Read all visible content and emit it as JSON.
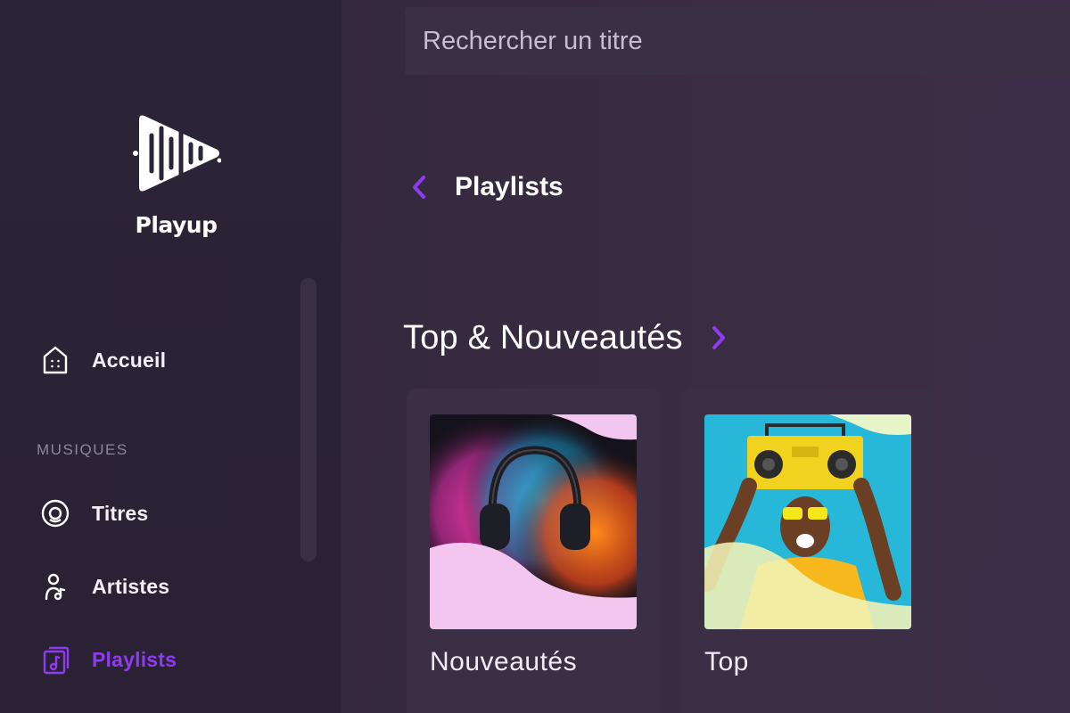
{
  "app": {
    "name": "Playup",
    "accent_color": "#8f3bf0"
  },
  "search": {
    "placeholder": "Rechercher un titre",
    "value": ""
  },
  "sidebar": {
    "home": {
      "label": "Accueil",
      "icon": "home-icon"
    },
    "section_label": "MUSIQUES",
    "items": [
      {
        "label": "Titres",
        "icon": "disc-icon",
        "active": false
      },
      {
        "label": "Artistes",
        "icon": "artist-icon",
        "active": false
      },
      {
        "label": "Playlists",
        "icon": "playlist-icon",
        "active": true
      }
    ]
  },
  "header": {
    "back_icon": "chevron-left-icon",
    "title": "Playlists"
  },
  "section": {
    "title": "Top & Nouveautés",
    "next_icon": "chevron-right-icon"
  },
  "cards": [
    {
      "title": "Nouveautés",
      "art": "headphones-color-splash"
    },
    {
      "title": "Top",
      "art": "man-holding-boombox"
    }
  ]
}
